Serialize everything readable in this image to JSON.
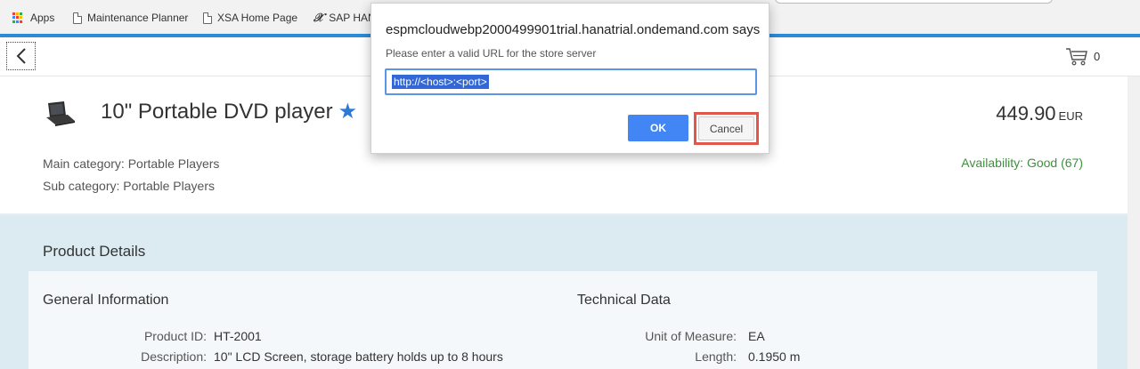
{
  "bookmarks": [
    {
      "label": "Apps",
      "icon": "apps-grid-icon"
    },
    {
      "label": "Maintenance Planner",
      "icon": "page-icon"
    },
    {
      "label": "XSA Home Page",
      "icon": "page-icon"
    },
    {
      "label": "SAP HAN",
      "icon": "xs-logo-icon"
    }
  ],
  "header": {
    "back_icon": "chevron-left-icon",
    "cart_icon": "cart-icon",
    "cart_count": "0"
  },
  "product": {
    "title": "10\" Portable DVD player",
    "star": "★",
    "price": "449.90",
    "currency": "EUR",
    "main_category": "Main category: Portable Players",
    "sub_category": "Sub category: Portable Players",
    "availability": "Availability: Good (67)"
  },
  "details": {
    "title": "Product Details",
    "general": {
      "heading": "General Information",
      "rows": [
        {
          "label": "Product ID:",
          "value": "HT-2001"
        },
        {
          "label": "Description:",
          "value": "10\" LCD Screen, storage battery holds up to 8 hours"
        }
      ]
    },
    "technical": {
      "heading": "Technical Data",
      "rows": [
        {
          "label": "Unit of Measure:",
          "value": "EA"
        },
        {
          "label": "Length:",
          "value": "0.1950 m"
        }
      ]
    }
  },
  "dialog": {
    "title": "espmcloudwebp2000499901trial.hanatrial.ondemand.com says",
    "message": "Please enter a valid URL for the store server",
    "input_value": "http://<host>:<port>",
    "ok_label": "OK",
    "cancel_label": "Cancel"
  },
  "colors": {
    "accent": "#2a8bd9",
    "star": "#2a7ad6",
    "availability": "#3f8f3f",
    "ok_button": "#4285f4",
    "highlight_box": "#e2574c",
    "details_bg": "#dcebf1"
  }
}
